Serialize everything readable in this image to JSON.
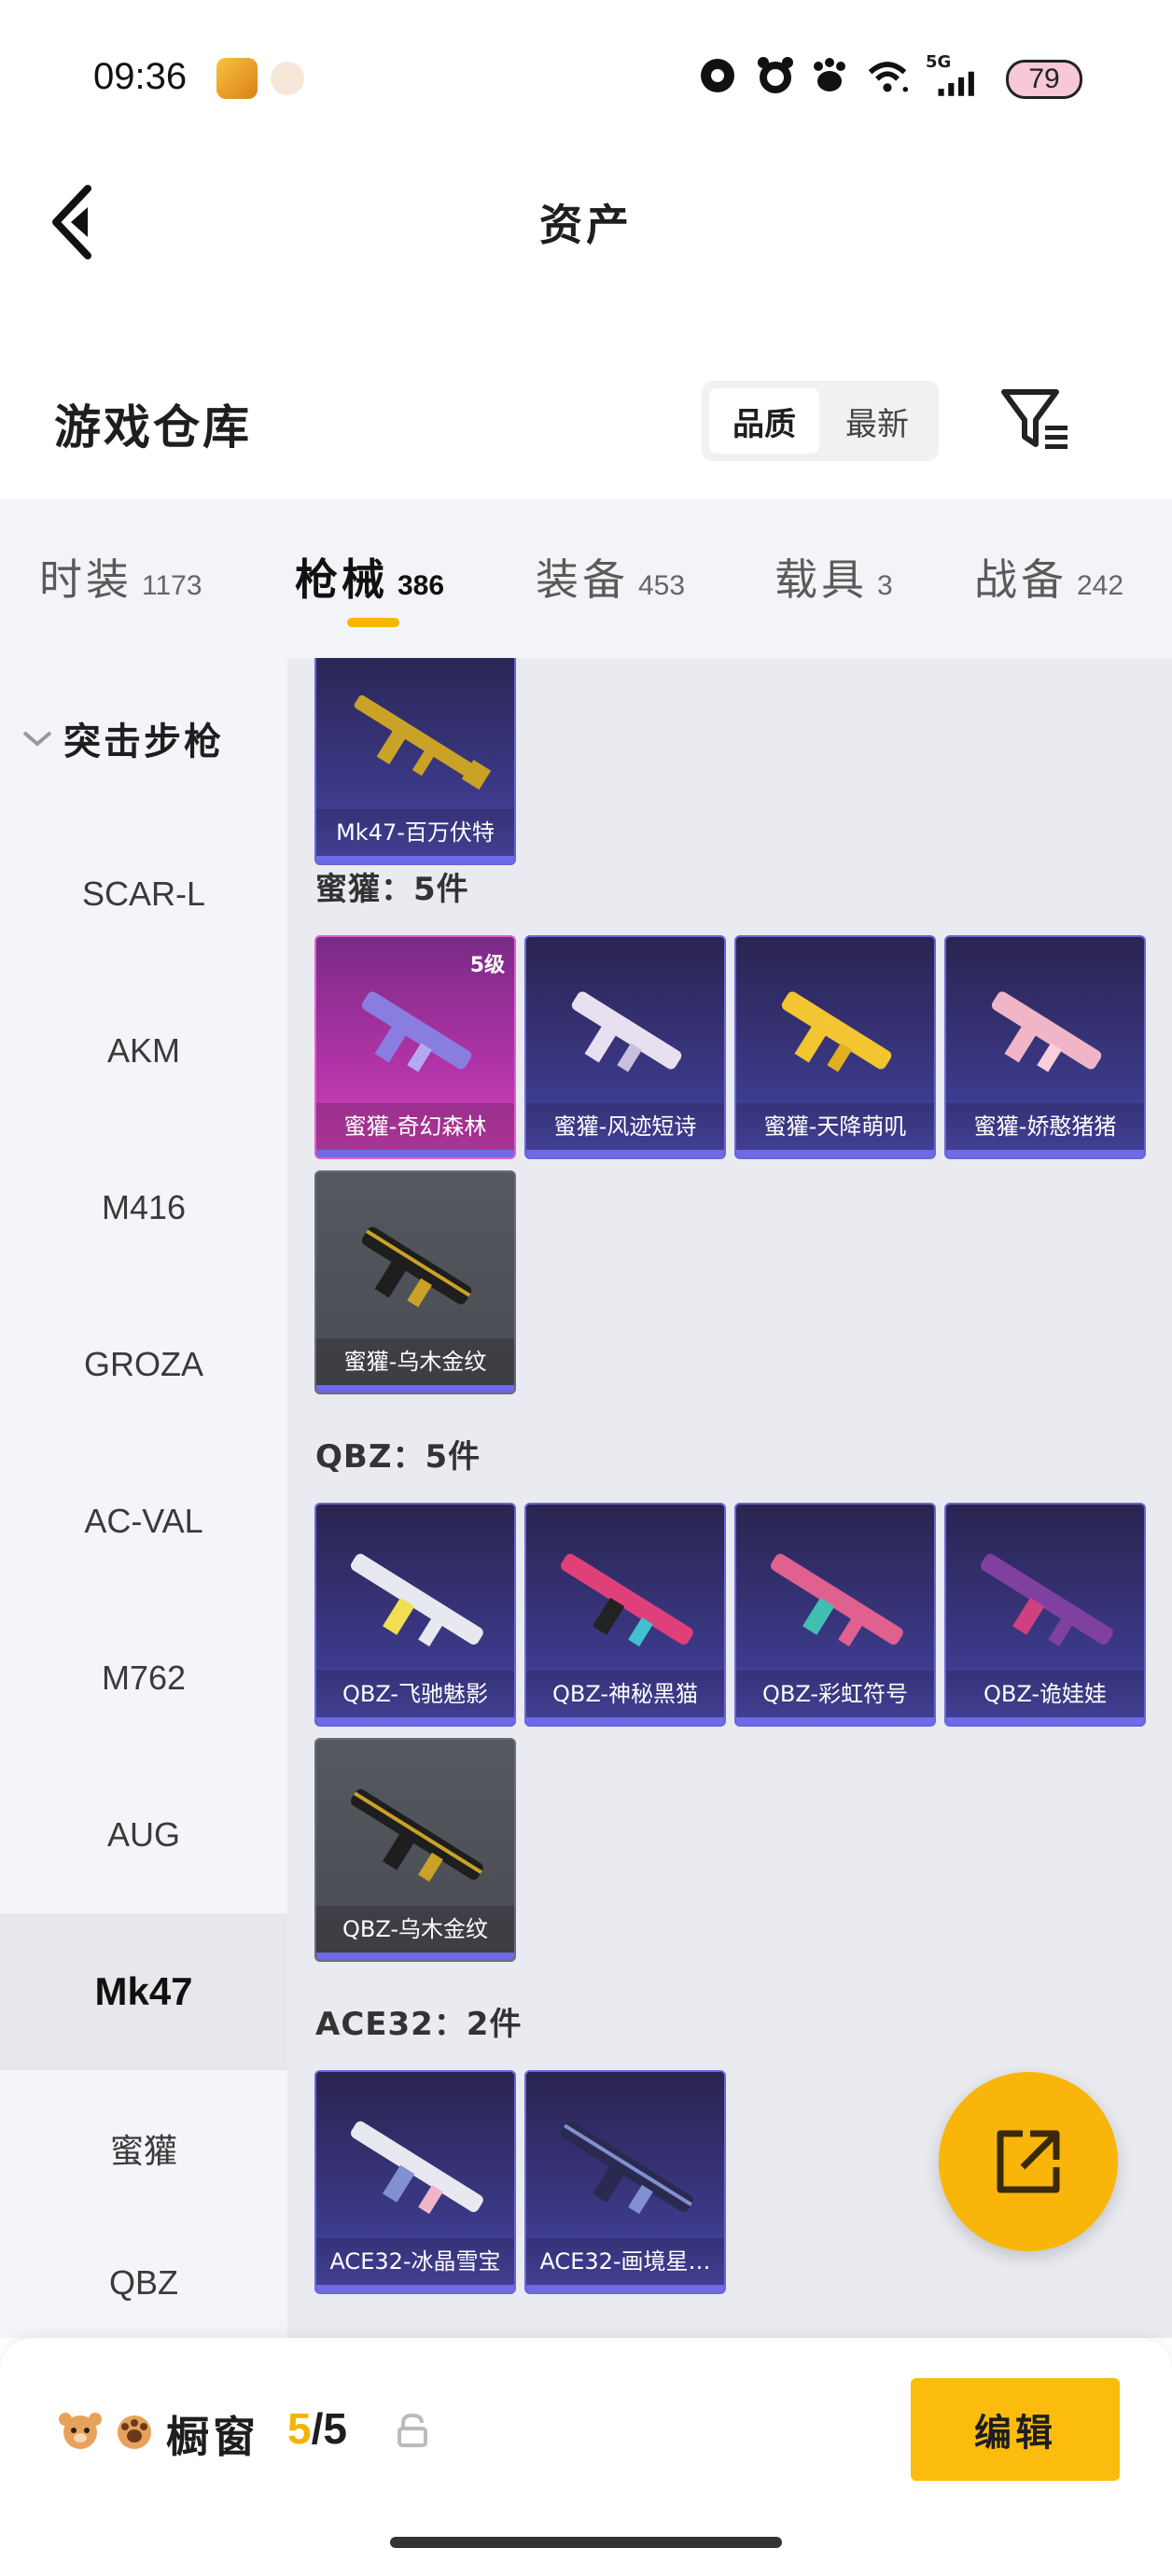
{
  "status_bar": {
    "time": "09:36",
    "battery": "79",
    "network": "5G"
  },
  "header": {
    "title": "资产"
  },
  "warehouse": {
    "title": "游戏仓库",
    "sort_options": [
      "品质",
      "最新"
    ],
    "active_sort": "品质"
  },
  "tabs": [
    {
      "label": "时装",
      "count": "1173",
      "active": false
    },
    {
      "label": "枪械",
      "count": "386",
      "active": true
    },
    {
      "label": "装备",
      "count": "453",
      "active": false
    },
    {
      "label": "载具",
      "count": "3",
      "active": false
    },
    {
      "label": "战备",
      "count": "242",
      "active": false
    }
  ],
  "sidebar": {
    "category": "突击步枪",
    "items": [
      "SCAR-L",
      "AKM",
      "M416",
      "GROZA",
      "AC-VAL",
      "M762",
      "AUG",
      "Mk47",
      "蜜獾",
      "QBZ"
    ],
    "active": "Mk47"
  },
  "sections": [
    {
      "header": "",
      "items": [
        {
          "name": "Mk47-百万伏特",
          "tier": "purple",
          "level": ""
        }
      ]
    },
    {
      "header": "蜜獾：5件",
      "items": [
        {
          "name": "蜜獾-奇幻森林",
          "tier": "pink",
          "level": "5级"
        },
        {
          "name": "蜜獾-风迹短诗",
          "tier": "purple",
          "level": ""
        },
        {
          "name": "蜜獾-天降萌叽",
          "tier": "purple",
          "level": ""
        },
        {
          "name": "蜜獾-娇憨猪猪",
          "tier": "purple",
          "level": ""
        },
        {
          "name": "蜜獾-乌木金纹",
          "tier": "grey",
          "level": ""
        }
      ]
    },
    {
      "header": "QBZ：5件",
      "items": [
        {
          "name": "QBZ-飞驰魅影",
          "tier": "purple",
          "level": ""
        },
        {
          "name": "QBZ-神秘黑猫",
          "tier": "purple",
          "level": ""
        },
        {
          "name": "QBZ-彩虹符号",
          "tier": "purple",
          "level": ""
        },
        {
          "name": "QBZ-诡娃娃",
          "tier": "purple",
          "level": ""
        },
        {
          "name": "QBZ-乌木金纹",
          "tier": "grey",
          "level": ""
        }
      ]
    },
    {
      "header": "ACE32：2件",
      "items": [
        {
          "name": "ACE32-冰晶雪宝",
          "tier": "purple",
          "level": ""
        },
        {
          "name": "ACE32-画境星…",
          "tier": "purple",
          "level": ""
        }
      ]
    }
  ],
  "bottom_bar": {
    "label": "橱窗",
    "count_current": "5",
    "count_sep": "/",
    "count_total": "5",
    "edit_label": "编辑"
  },
  "colors": {
    "accent": "#fbbc0d",
    "purple_card": "#3c3a8a",
    "pink_card": "#b234a8",
    "grey_card": "#4a4c52"
  },
  "gun_colors": [
    "#c9a227",
    "#8a7de0",
    "#e8e0f0",
    "#f2c531",
    "#f0b6c8",
    "#c9a227",
    "#f0e050",
    "#e0407a",
    "#e06090",
    "#8040a0",
    "#c9a227",
    "#e8e8f0",
    "#8090d0"
  ]
}
